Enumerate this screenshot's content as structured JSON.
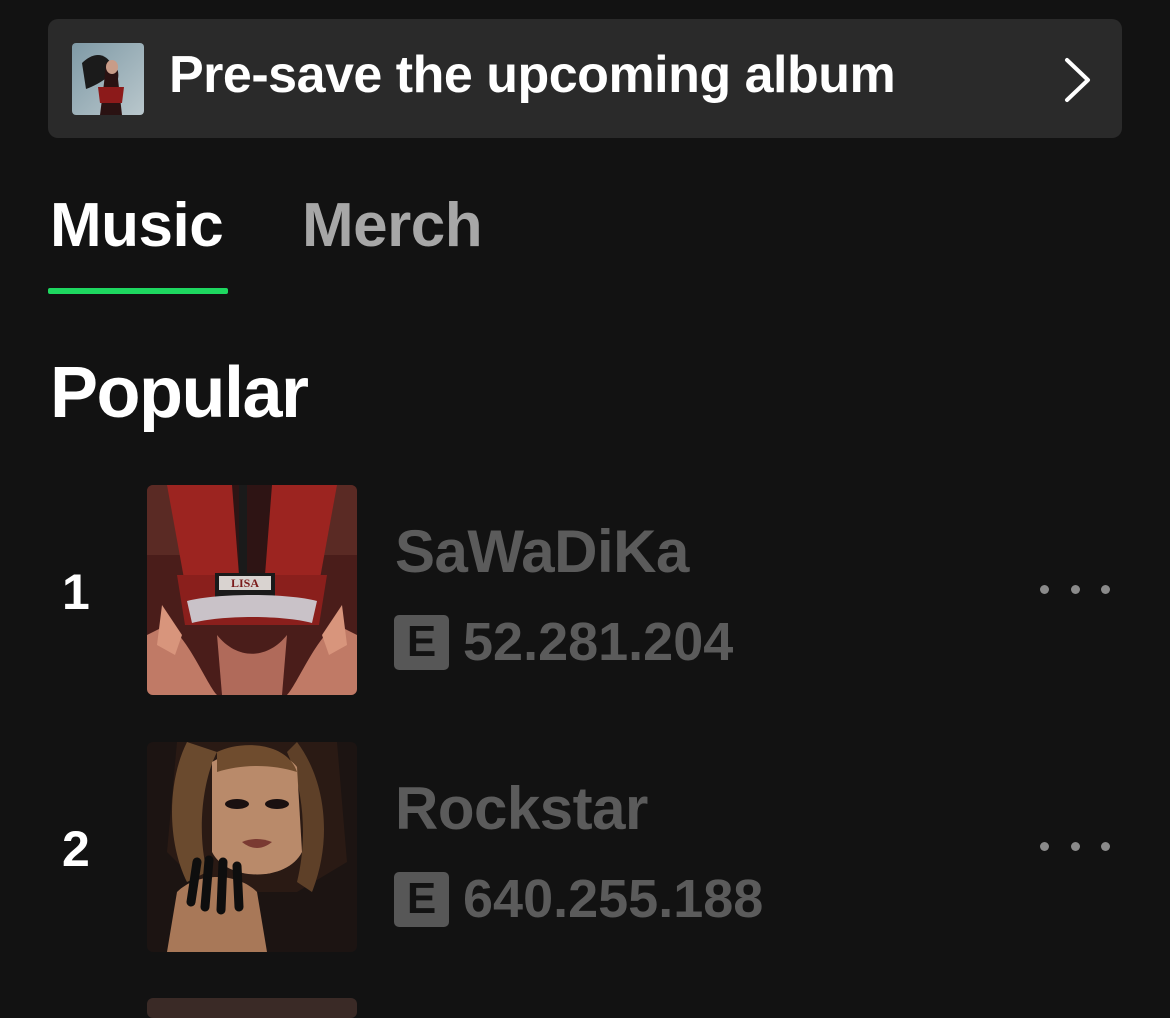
{
  "banner": {
    "text": "Pre-save the upcoming album",
    "thumbnail_icon": "album-cover-thumbnail",
    "chevron_icon": "chevron-right-icon"
  },
  "tabs": [
    {
      "label": "Music",
      "active": true
    },
    {
      "label": "Merch",
      "active": false
    }
  ],
  "accent_color": "#1ed760",
  "section": {
    "title": "Popular"
  },
  "tracks": [
    {
      "rank": "1",
      "title": "SaWaDiKa",
      "explicit": "E",
      "plays": "52.281.204",
      "art_label": "LISA"
    },
    {
      "rank": "2",
      "title": "Rockstar",
      "explicit": "E",
      "plays": "640.255.188"
    }
  ]
}
